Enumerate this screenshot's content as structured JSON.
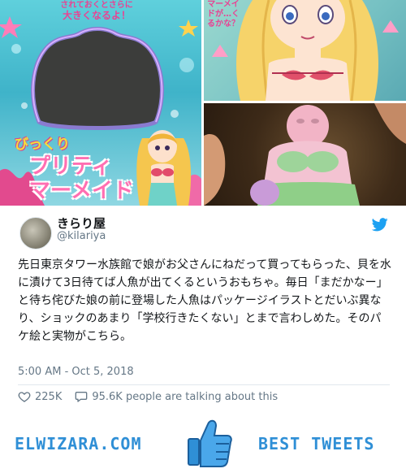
{
  "images": {
    "package_top_text_line1": "されておくとさらに",
    "package_top_text_line2": "大きくなるよ！",
    "package_title_small": "びっくり",
    "package_title_main_line1": "プリティ",
    "package_title_main_line2": "マーメイド",
    "illustration_side_text": "マーメイドが…くるかな？"
  },
  "tweet": {
    "display_name": "きらり屋",
    "handle": "@kilariya",
    "text": "先日東京タワー水族館で娘がお父さんにねだって買ってもらった、貝を水に漬けて3日待てば人魚が出てくるというおもちゃ。毎日「まだかなー」と待ち侘びた娘の前に登場した人魚はパッケージイラストとだいぶ異なり、ショックのあまり「学校行きたくない」とまで言わしめた。そのパケ絵と実物がこちら。",
    "timestamp": "5:00 AM - Oct 5, 2018",
    "likes": "225K",
    "talking": "95.6K people are talking about this"
  },
  "footer": {
    "left_label": "ELWIZARA.COM",
    "right_label": "BEST TWEETS"
  },
  "colors": {
    "twitter_blue": "#1da1f2",
    "footer_blue": "#2f8fd6",
    "text": "#14171a",
    "secondary_text": "#657786"
  },
  "icons": {
    "brand": "twitter-bird-icon",
    "like": "heart-outline-icon",
    "reply": "speech-bubble-icon",
    "footer": "thumbs-up-icon"
  }
}
